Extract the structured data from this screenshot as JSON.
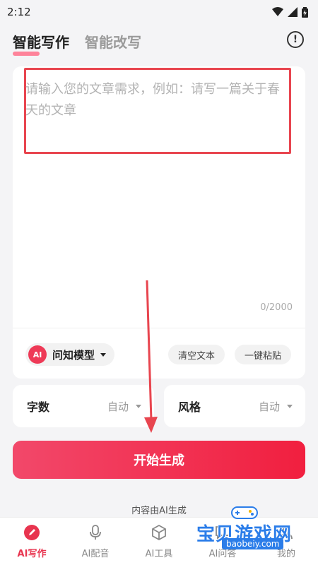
{
  "status": {
    "time": "2:12"
  },
  "header": {
    "tabs": [
      {
        "label": "智能写作",
        "active": true
      },
      {
        "label": "智能改写",
        "active": false
      }
    ],
    "info_glyph": "!"
  },
  "editor": {
    "placeholder": "请输入您的文章需求，例如：请写一篇关于春天的文章",
    "counter": "0/2000",
    "model": {
      "logo_text": "AI",
      "label": "问知模型"
    },
    "clear_label": "清空文本",
    "paste_label": "一键粘贴"
  },
  "options": {
    "words": {
      "label": "字数",
      "value": "自动"
    },
    "style": {
      "label": "风格",
      "value": "自动"
    }
  },
  "generate_label": "开始生成",
  "ai_note": "内容由AI生成",
  "nav": [
    {
      "label": "AI写作",
      "icon": "pen-icon",
      "active": true
    },
    {
      "label": "AI配音",
      "icon": "microphone-icon",
      "active": false
    },
    {
      "label": "AI工具",
      "icon": "cube-icon",
      "active": false
    },
    {
      "label": "AI问答",
      "icon": "chat-icon",
      "active": false
    },
    {
      "label": "我的",
      "icon": "profile-icon",
      "active": false
    }
  ],
  "watermark": {
    "title": "宝贝游戏网",
    "url": "baobeiy.com"
  },
  "colors": {
    "accent": "#f11f3f",
    "annotation": "#e8454f",
    "watermark": "#2b7de9"
  }
}
